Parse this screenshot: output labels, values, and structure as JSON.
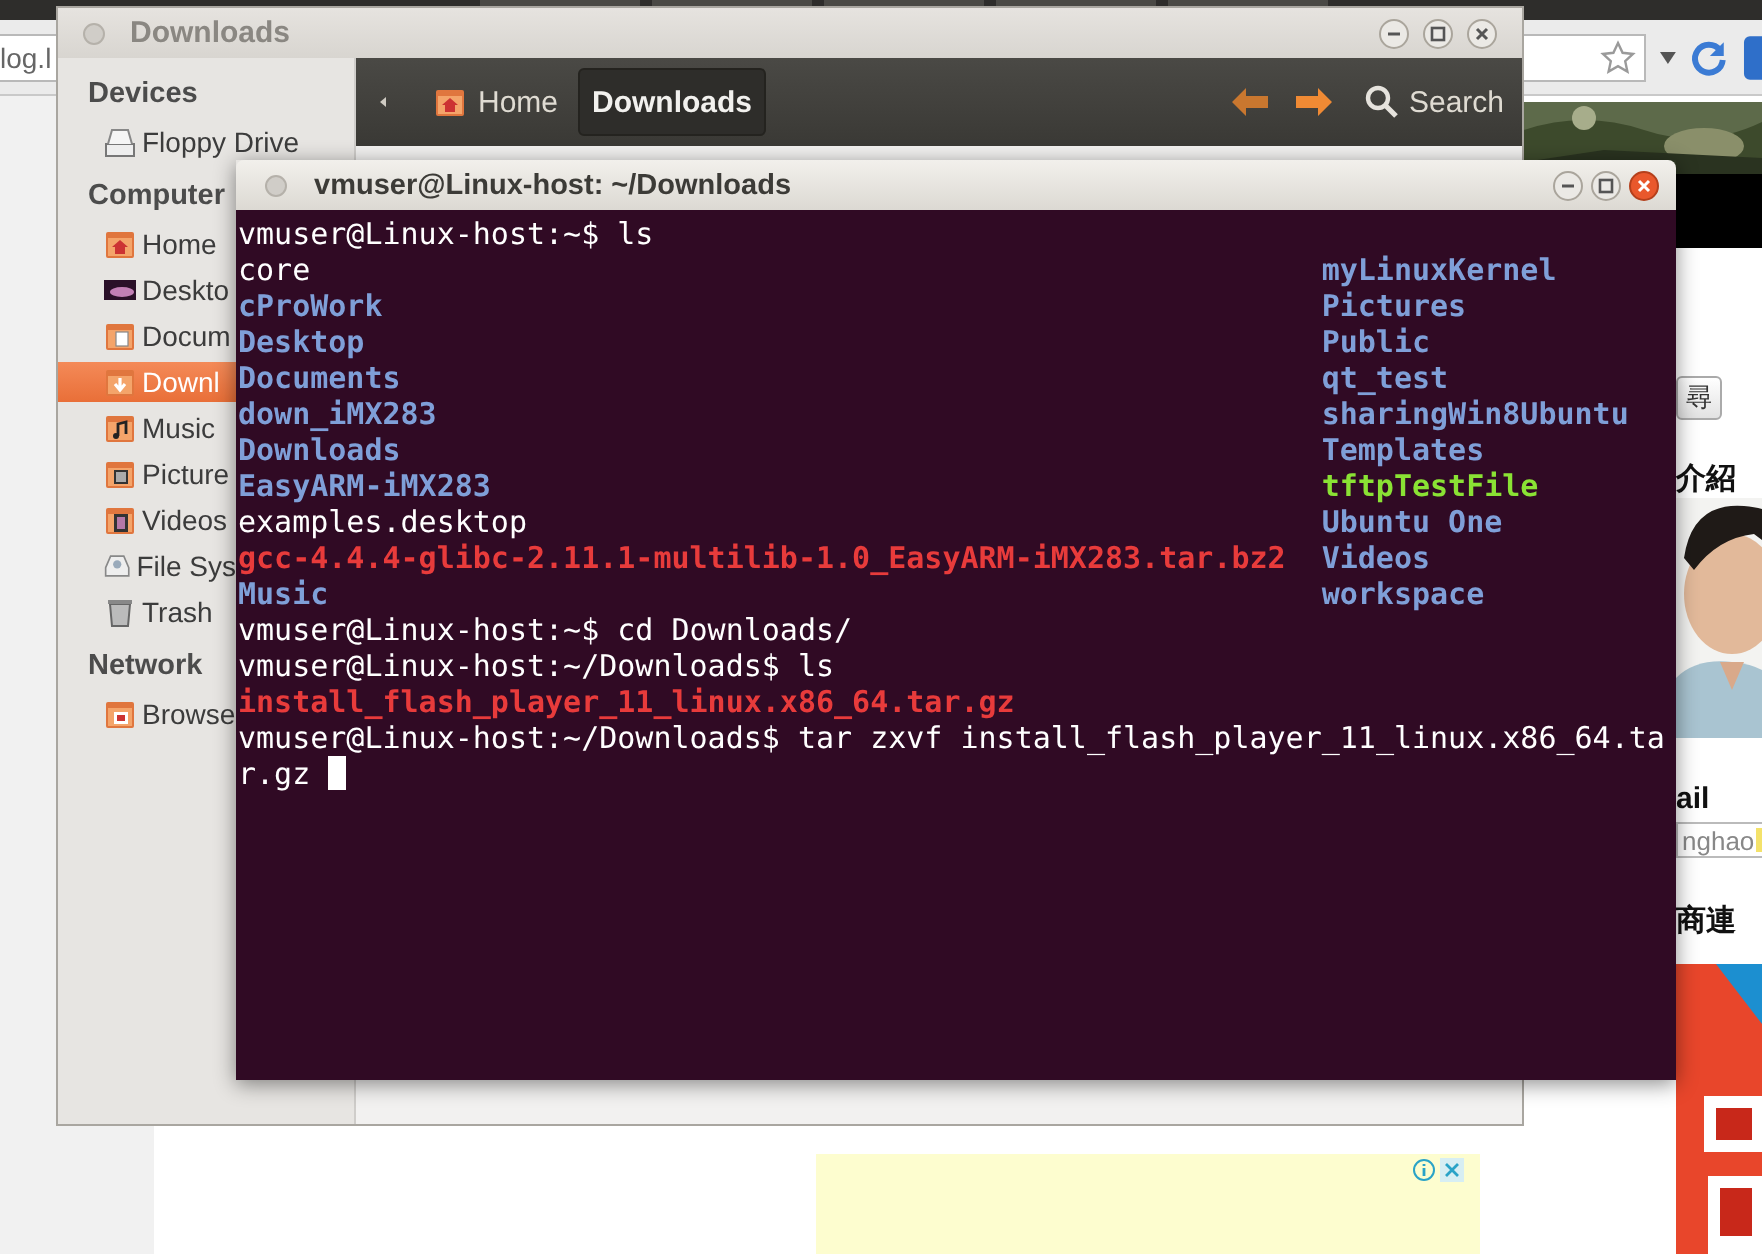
{
  "browser": {
    "address": "log.l",
    "side_panel": {
      "search_button": "尋",
      "heading": "介紹",
      "label": "ail",
      "email_field": {
        "value": "nghao"
      },
      "sponsor_heading": "商連"
    }
  },
  "file_manager": {
    "title": "Downloads",
    "sidebar": [
      {
        "heading": "Devices",
        "items": [
          {
            "label": "Floppy Drive",
            "selected": false
          }
        ]
      },
      {
        "heading": "Computer",
        "items": [
          {
            "label": "Home",
            "selected": false
          },
          {
            "label": "Deskto",
            "selected": false
          },
          {
            "label": "Docum",
            "selected": false
          },
          {
            "label": "Downl",
            "selected": true
          },
          {
            "label": "Music",
            "selected": false
          },
          {
            "label": "Picture",
            "selected": false
          },
          {
            "label": "Videos",
            "selected": false
          },
          {
            "label": "File Sys",
            "selected": false
          },
          {
            "label": "Trash",
            "selected": false
          }
        ]
      },
      {
        "heading": "Network",
        "items": [
          {
            "label": "Browse",
            "selected": false
          }
        ]
      }
    ],
    "path_bar": [
      {
        "label": "Home",
        "selected": false
      },
      {
        "label": "Downloads",
        "selected": true
      }
    ],
    "search": "Search"
  },
  "terminal": {
    "title": "vmuser@Linux-host: ~/Downloads",
    "session": [
      {
        "kind": "command",
        "text": "vmuser@Linux-host:~$ ls"
      },
      {
        "kind": "listing",
        "columns": [
          [
            {
              "name": "core",
              "kind": "file"
            },
            {
              "name": "cProWork",
              "kind": "directory"
            },
            {
              "name": "Desktop",
              "kind": "directory"
            },
            {
              "name": "Documents",
              "kind": "directory"
            },
            {
              "name": "down_iMX283",
              "kind": "directory"
            },
            {
              "name": "Downloads",
              "kind": "directory"
            },
            {
              "name": "EasyARM-iMX283",
              "kind": "directory"
            },
            {
              "name": "examples.desktop",
              "kind": "file"
            },
            {
              "name": "gcc-4.4.4-glibc-2.11.1-multilib-1.0_EasyARM-iMX283.tar.bz2",
              "kind": "archive"
            },
            {
              "name": "Music",
              "kind": "directory"
            }
          ],
          [
            {
              "name": "myLinuxKernel",
              "kind": "directory"
            },
            {
              "name": "Pictures",
              "kind": "directory"
            },
            {
              "name": "Public",
              "kind": "directory"
            },
            {
              "name": "qt_test",
              "kind": "directory"
            },
            {
              "name": "sharingWin8Ubuntu",
              "kind": "directory"
            },
            {
              "name": "Templates",
              "kind": "directory"
            },
            {
              "name": "tftpTestFile",
              "kind": "executable"
            },
            {
              "name": "Ubuntu One",
              "kind": "directory"
            },
            {
              "name": "Videos",
              "kind": "directory"
            },
            {
              "name": "workspace",
              "kind": "directory"
            }
          ]
        ]
      },
      {
        "kind": "command",
        "text": "vmuser@Linux-host:~$ cd Downloads/"
      },
      {
        "kind": "command",
        "text": "vmuser@Linux-host:~/Downloads$ ls"
      },
      {
        "kind": "listing",
        "columns": [
          [
            {
              "name": "install_flash_player_11_linux.x86_64.tar.gz",
              "kind": "archive"
            }
          ]
        ]
      },
      {
        "kind": "command",
        "text": "vmuser@Linux-host:~/Downloads$ tar zxvf install_flash_player_11_linux.x86_64.tar.gz",
        "cursor": true
      }
    ]
  }
}
